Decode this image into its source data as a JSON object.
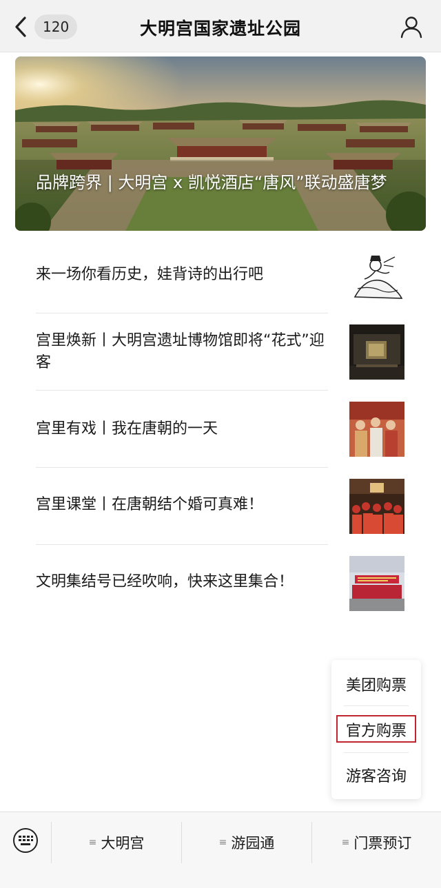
{
  "navbar": {
    "back_count": "120",
    "title": "大明宫国家遗址公园",
    "back_icon": "chevron-left-icon",
    "profile_icon": "user-icon"
  },
  "hero": {
    "title": "品牌跨界 | 大明宫 x 凯悦酒店“唐风”联动盛唐梦"
  },
  "articles": [
    {
      "title": "来一场你看历史，娃背诗的出行吧"
    },
    {
      "title": "宫里焕新丨大明宫遗址博物馆即将“花式”迎客"
    },
    {
      "title": "宫里有戏丨我在唐朝的一天"
    },
    {
      "title": "宫里课堂丨在唐朝结个婚可真难！"
    },
    {
      "title": "文明集结号已经吹响，快来这里集合！"
    }
  ],
  "popup": {
    "items": [
      {
        "label": "美团购票"
      },
      {
        "label": "官方购票"
      },
      {
        "label": "游客咨询"
      }
    ],
    "highlight_color": "#c0242c"
  },
  "tabbar": {
    "keyboard_icon": "keyboard-icon",
    "menu_glyph": "≡",
    "tabs": [
      {
        "label": "大明宫"
      },
      {
        "label": "游园通"
      },
      {
        "label": "门票预订"
      }
    ]
  },
  "colors": {
    "navbar_bg": "#f2f2f2",
    "tabbar_bg": "#f7f7f7",
    "text": "#1a1a1a"
  }
}
